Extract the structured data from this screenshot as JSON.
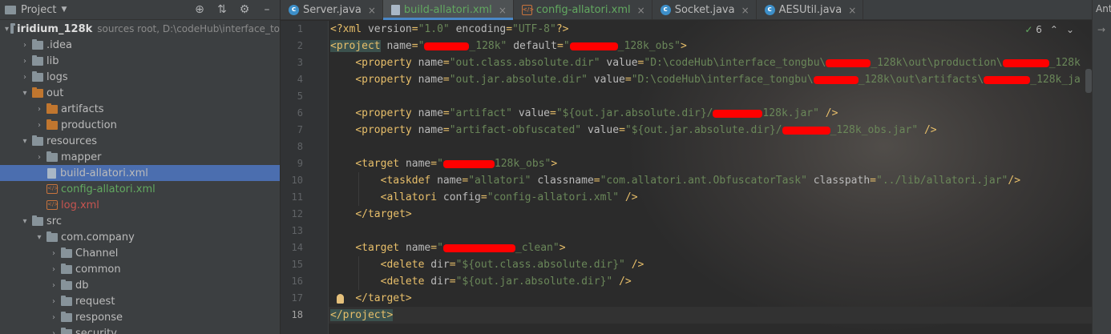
{
  "project_panel": {
    "title": "Project",
    "tree": [
      {
        "label": "iridium_128k",
        "extra": "sources root,  D:\\codeHub\\interface_to",
        "arrow": "▾",
        "indent": 0,
        "icon": "dir",
        "style": "bold"
      },
      {
        "label": ".idea",
        "arrow": "›",
        "indent": 1,
        "icon": "dir"
      },
      {
        "label": "lib",
        "arrow": "›",
        "indent": 1,
        "icon": "dir"
      },
      {
        "label": "logs",
        "arrow": "›",
        "indent": 1,
        "icon": "dir"
      },
      {
        "label": "out",
        "arrow": "▾",
        "indent": 1,
        "icon": "orange"
      },
      {
        "label": "artifacts",
        "arrow": "›",
        "indent": 2,
        "icon": "orange"
      },
      {
        "label": "production",
        "arrow": "›",
        "indent": 2,
        "icon": "orange"
      },
      {
        "label": "resources",
        "arrow": "▾",
        "indent": 1,
        "icon": "dir"
      },
      {
        "label": "mapper",
        "arrow": "›",
        "indent": 2,
        "icon": "dir"
      },
      {
        "label": "build-allatori.xml",
        "arrow": "",
        "indent": 2,
        "icon": "file",
        "selected": true
      },
      {
        "label": "config-allatori.xml",
        "arrow": "",
        "indent": 2,
        "icon": "xml",
        "style": "green"
      },
      {
        "label": "log.xml",
        "arrow": "",
        "indent": 2,
        "icon": "xml",
        "style": "red"
      },
      {
        "label": "src",
        "arrow": "▾",
        "indent": 1,
        "icon": "dir"
      },
      {
        "label": "com.company",
        "arrow": "▾",
        "indent": 2,
        "icon": "dir"
      },
      {
        "label": "Channel",
        "arrow": "›",
        "indent": 3,
        "icon": "dir"
      },
      {
        "label": "common",
        "arrow": "›",
        "indent": 3,
        "icon": "dir"
      },
      {
        "label": "db",
        "arrow": "›",
        "indent": 3,
        "icon": "dir"
      },
      {
        "label": "request",
        "arrow": "›",
        "indent": 3,
        "icon": "dir"
      },
      {
        "label": "response",
        "arrow": "›",
        "indent": 3,
        "icon": "dir"
      },
      {
        "label": "security",
        "arrow": "›",
        "indent": 3,
        "icon": "dir"
      }
    ]
  },
  "tabs": [
    {
      "label": "Server.java",
      "icon": "c",
      "style": ""
    },
    {
      "label": "build-allatori.xml",
      "icon": "file",
      "style": "green",
      "active": true
    },
    {
      "label": "config-allatori.xml",
      "icon": "xml",
      "style": "green"
    },
    {
      "label": "Socket.java",
      "icon": "c",
      "style": ""
    },
    {
      "label": "AESUtil.java",
      "icon": "c",
      "style": ""
    }
  ],
  "right_strip": {
    "top_label": "Ant",
    "second": "→"
  },
  "inspection": {
    "count": "6"
  },
  "editor": {
    "current_line": 18,
    "lines": [
      {
        "n": "1",
        "html": "<span class='t'>&lt;?xml</span> <span class='a'>version</span>=<span class='v'>\"1.0\"</span> <span class='a'>encoding</span>=<span class='v'>\"UTF-8\"</span><span class='t'>?&gt;</span>"
      },
      {
        "n": "2",
        "html": "<span class='b'>&lt;project</span> <span class='a'>name</span>=<span class='v'>\"<span class='redact' style='width:56px'></span>_128k\"</span> <span class='a'>default</span>=<span class='v'>\"<span class='redact' style='width:60px'></span>_128k_obs\"</span><span class='t'>&gt;</span>"
      },
      {
        "n": "3",
        "html": "    <span class='t'>&lt;property</span> <span class='a'>name</span>=<span class='v'>\"out.class.absolute.dir\"</span> <span class='a'>value</span>=<span class='v'>\"D:\\codeHub\\interface_tongbu\\<span class='redact' style='width:56px'></span>_128k\\out\\production\\<span class='redact' style='width:58px'></span>_128k</span>"
      },
      {
        "n": "4",
        "html": "    <span class='t'>&lt;property</span> <span class='a'>name</span>=<span class='v'>\"out.jar.absolute.dir\"</span> <span class='a'>value</span>=<span class='v'>\"D:\\codeHub\\interface_tongbu\\<span class='redact' style='width:56px'></span>_128k\\out\\artifacts\\<span class='redact' style='width:58px'></span>_128k_ja</span>"
      },
      {
        "n": "5",
        "html": ""
      },
      {
        "n": "6",
        "html": "    <span class='t'>&lt;property</span> <span class='a'>name</span>=<span class='v'>\"artifact\"</span> <span class='a'>value</span>=<span class='v'>\"${out.jar.absolute.dir}/<span class='redact' style='width:62px'></span>128k.jar\"</span> <span class='t'>/&gt;</span>"
      },
      {
        "n": "7",
        "html": "    <span class='t'>&lt;property</span> <span class='a'>name</span>=<span class='v'>\"artifact-obfuscated\"</span> <span class='a'>value</span>=<span class='v'>\"${out.jar.absolute.dir}/<span class='redact' style='width:60px'></span>_128k_obs.jar\"</span> <span class='t'>/&gt;</span>"
      },
      {
        "n": "8",
        "html": ""
      },
      {
        "n": "9",
        "html": "    <span class='t'>&lt;target</span> <span class='a'>name</span>=<span class='v'>\"<span class='redact' style='width:64px'></span>128k_obs\"</span><span class='t'>&gt;</span>"
      },
      {
        "n": "10",
        "html": "        <span class='t'>&lt;taskdef</span> <span class='a'>name</span>=<span class='v'>\"allatori\"</span> <span class='a'>classname</span>=<span class='v'>\"com.allatori.ant.ObfuscatorTask\"</span> <span class='a'>classpath</span>=<span class='v'>\"../lib/allatori.jar\"</span><span class='t'>/&gt;</span>"
      },
      {
        "n": "11",
        "html": "        <span class='t'>&lt;allatori</span> <span class='a'>config</span>=<span class='v'>\"config-allatori.xml\"</span> <span class='t'>/&gt;</span>"
      },
      {
        "n": "12",
        "html": "    <span class='t'>&lt;/target&gt;</span>"
      },
      {
        "n": "13",
        "html": ""
      },
      {
        "n": "14",
        "html": "    <span class='t'>&lt;target</span> <span class='a'>name</span>=<span class='v'>\"<span class='redact' style='width:90px'></span>_clean\"</span><span class='t'>&gt;</span>"
      },
      {
        "n": "15",
        "html": "        <span class='t'>&lt;delete</span> <span class='a'>dir</span>=<span class='v'>\"${out.class.absolute.dir}\"</span> <span class='t'>/&gt;</span>"
      },
      {
        "n": "16",
        "html": "        <span class='t'>&lt;delete</span> <span class='a'>dir</span>=<span class='v'>\"${out.jar.absolute.dir}\"</span> <span class='t'>/&gt;</span>"
      },
      {
        "n": "17",
        "html": "    <span class='t'>&lt;/target&gt;</span>"
      },
      {
        "n": "18",
        "html": "<span class='b'>&lt;/project&gt;</span>"
      }
    ]
  }
}
